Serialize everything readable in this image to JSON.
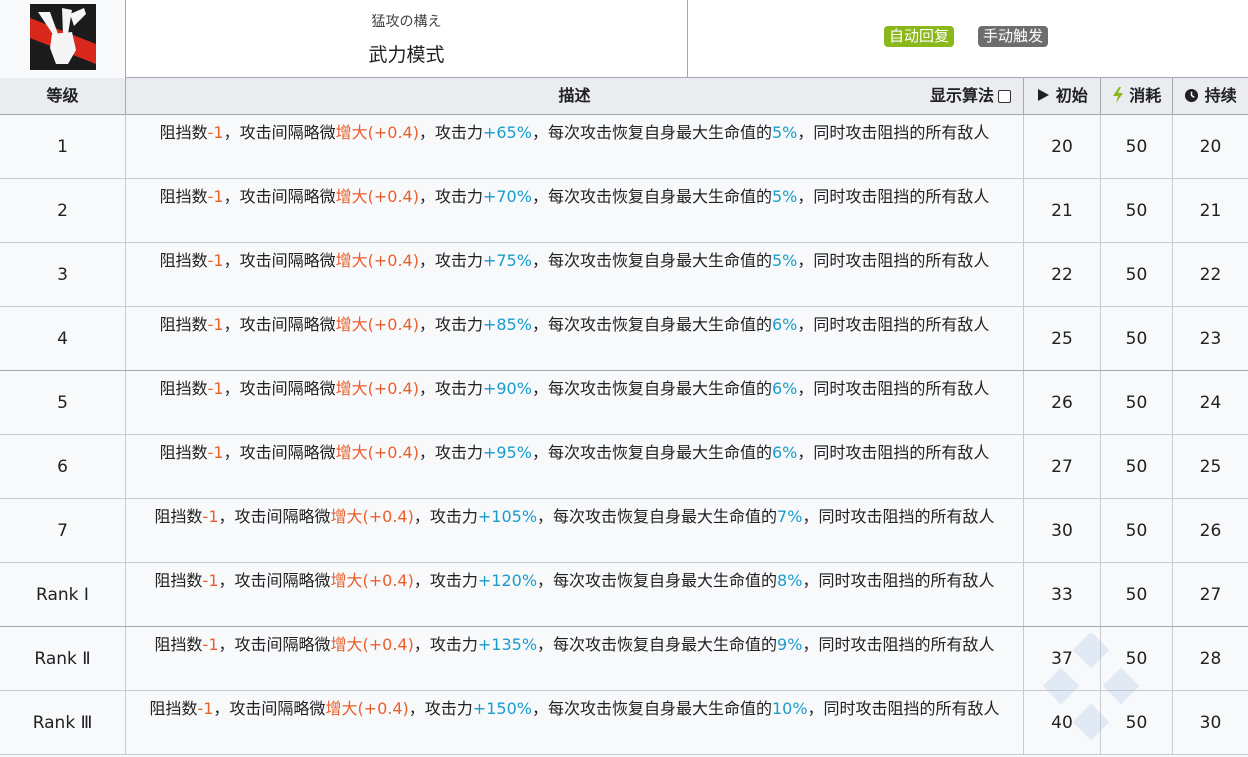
{
  "skill": {
    "jp_name": "猛攻の構え",
    "cn_name": "武力模式",
    "tag_auto": "自动回复",
    "tag_manual": "手动触发",
    "icon": "raised-fist-icon"
  },
  "table": {
    "headers": {
      "level": "等级",
      "desc": "描述",
      "algo": "显示算法",
      "initial": "初始",
      "cost": "消耗",
      "duration": "持续"
    },
    "rows": [
      {
        "level": "1",
        "atk": "+65%",
        "heal": "5%",
        "initial": "20",
        "cost": "50",
        "duration": "20"
      },
      {
        "level": "2",
        "atk": "+70%",
        "heal": "5%",
        "initial": "21",
        "cost": "50",
        "duration": "21"
      },
      {
        "level": "3",
        "atk": "+75%",
        "heal": "5%",
        "initial": "22",
        "cost": "50",
        "duration": "22"
      },
      {
        "level": "4",
        "atk": "+85%",
        "heal": "6%",
        "initial": "25",
        "cost": "50",
        "duration": "23"
      },
      {
        "level": "5",
        "atk": "+90%",
        "heal": "6%",
        "initial": "26",
        "cost": "50",
        "duration": "24"
      },
      {
        "level": "6",
        "atk": "+95%",
        "heal": "6%",
        "initial": "27",
        "cost": "50",
        "duration": "25"
      },
      {
        "level": "7",
        "atk": "+105%",
        "heal": "7%",
        "initial": "30",
        "cost": "50",
        "duration": "26"
      },
      {
        "level": "Rank Ⅰ",
        "atk": "+120%",
        "heal": "8%",
        "initial": "33",
        "cost": "50",
        "duration": "27"
      },
      {
        "level": "Rank Ⅱ",
        "atk": "+135%",
        "heal": "9%",
        "initial": "37",
        "cost": "50",
        "duration": "28"
      },
      {
        "level": "Rank Ⅲ",
        "atk": "+150%",
        "heal": "10%",
        "initial": "40",
        "cost": "50",
        "duration": "30"
      }
    ],
    "desc_parts": {
      "p1": "阻挡数",
      "block": "-1",
      "p2": "，攻击间隔略微",
      "interval": "增大(+0.4)",
      "p3": "，攻击力",
      "p4": "，每次攻击恢复自身最大生命值的",
      "p5": "，同时攻击阻挡的所有敌人"
    }
  },
  "colors": {
    "red": "#e8602d",
    "blue": "#1a9ccb",
    "auto_tag": "#8ab71a",
    "manual_tag": "#6d6d6d"
  }
}
